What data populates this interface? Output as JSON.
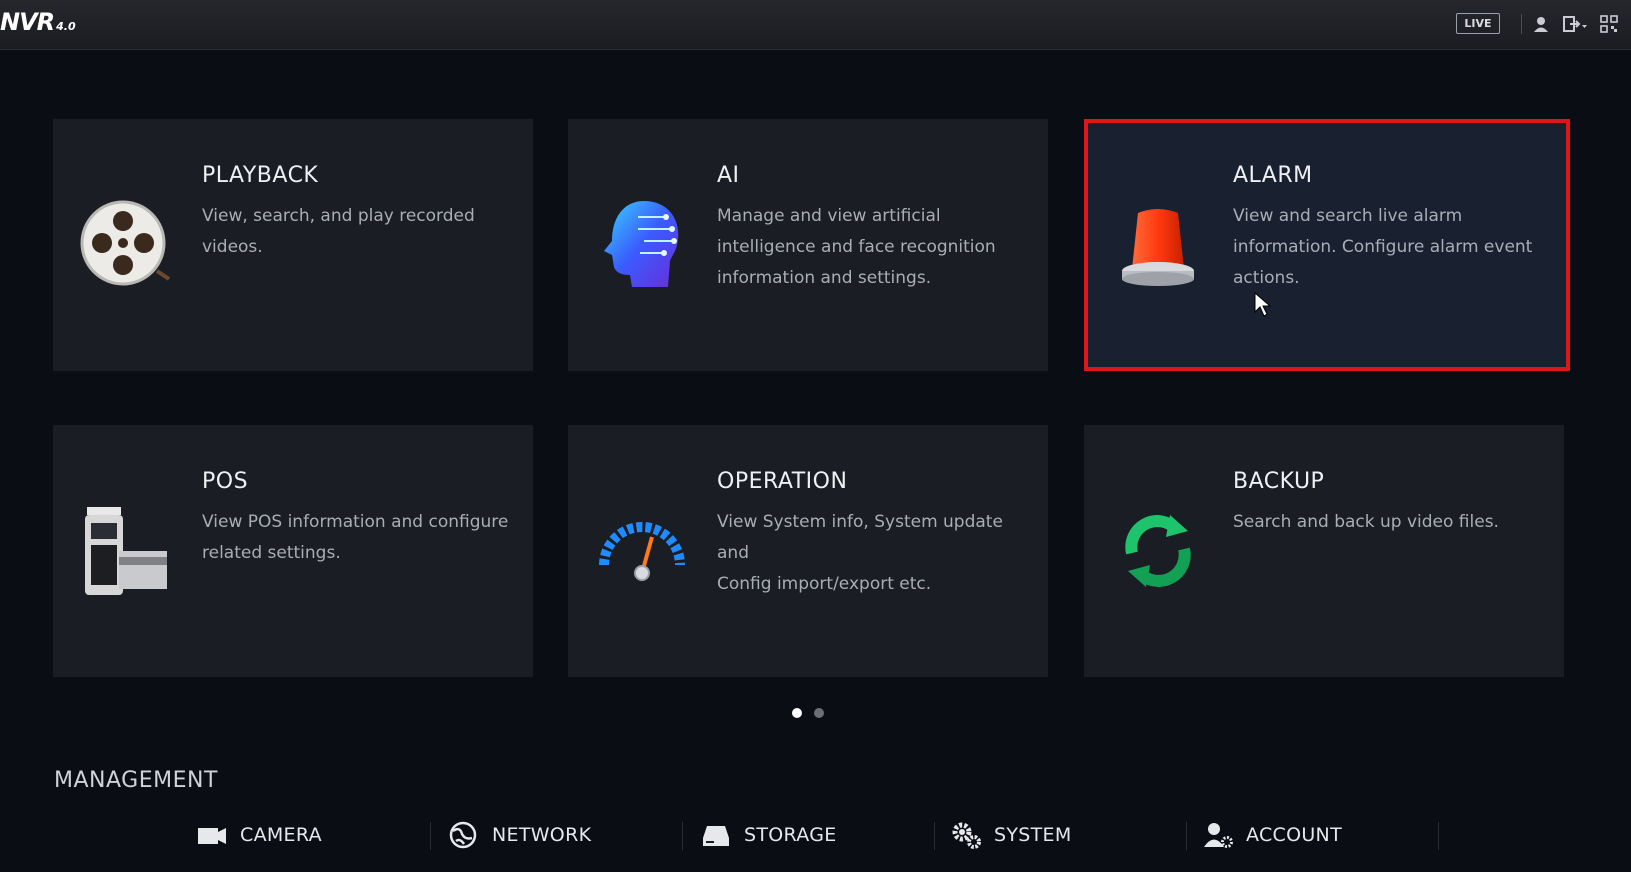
{
  "header": {
    "logo_text": "NVR",
    "logo_version": "4.0",
    "live_label": "LIVE",
    "icons": [
      "user-icon",
      "logout-icon",
      "qr-code-icon"
    ]
  },
  "cards": [
    {
      "title": "PLAYBACK",
      "desc": "View, search, and play recorded\nvideos.",
      "icon": "film-reel-icon",
      "selected": false
    },
    {
      "title": "AI",
      "desc": "Manage and view artificial\nintelligence and face recognition\ninformation and settings.",
      "icon": "ai-head-icon",
      "selected": false
    },
    {
      "title": "ALARM",
      "desc": "View and search live alarm\ninformation. Configure alarm event\nactions.",
      "icon": "alarm-siren-icon",
      "selected": true
    },
    {
      "title": "POS",
      "desc": "View POS information and configure\nrelated settings.",
      "icon": "pos-terminal-icon",
      "selected": false
    },
    {
      "title": "OPERATION",
      "desc": "View System info, System update and\n Config import/export etc.",
      "icon": "speedometer-icon",
      "selected": false
    },
    {
      "title": "BACKUP",
      "desc": "Search and back up video files.",
      "icon": "backup-sync-icon",
      "selected": false
    }
  ],
  "pagination": {
    "pages": 2,
    "current": 1
  },
  "management": {
    "title": "MANAGEMENT",
    "items": [
      {
        "label": "CAMERA",
        "icon": "camera-icon"
      },
      {
        "label": "NETWORK",
        "icon": "network-globe-icon"
      },
      {
        "label": "STORAGE",
        "icon": "storage-drive-icon"
      },
      {
        "label": "SYSTEM",
        "icon": "gears-icon"
      },
      {
        "label": "ACCOUNT",
        "icon": "account-settings-icon"
      }
    ]
  },
  "colors": {
    "selected_border": "#e0141b",
    "card_bg": "#1b1d24",
    "page_bg": "#0b0d14"
  }
}
